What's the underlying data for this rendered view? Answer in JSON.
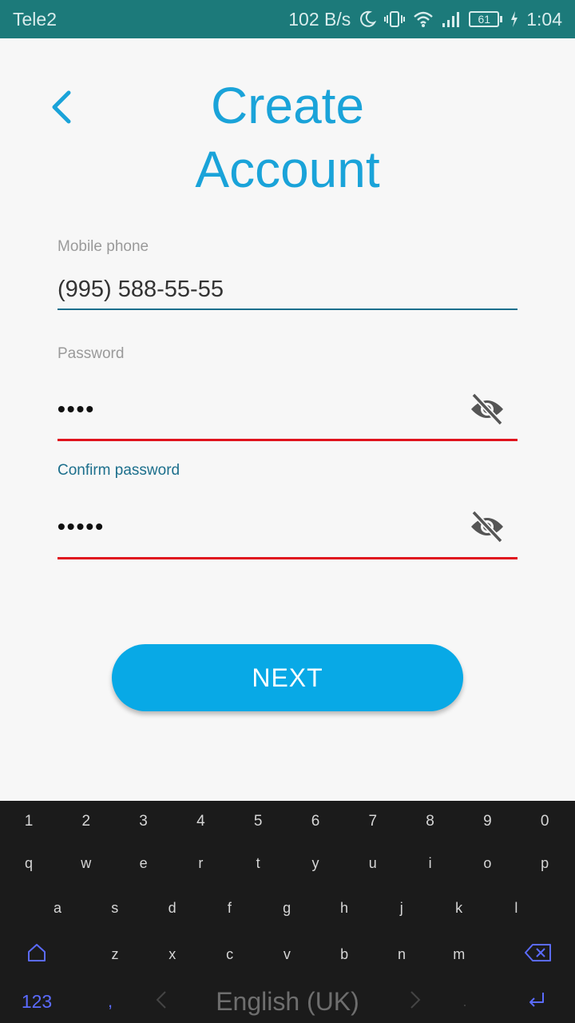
{
  "status_bar": {
    "carrier": "Tele2",
    "speed": "102 B/s",
    "battery": "61",
    "time": "1:04"
  },
  "header": {
    "title_line1": "Create",
    "title_line2": "Account"
  },
  "form": {
    "phone_label": "Mobile phone",
    "phone_value": "(995) 588-55-55",
    "password_label": "Password",
    "password_value": "••••",
    "confirm_label": "Confirm password",
    "confirm_value": "•••••"
  },
  "next_label": "NEXT",
  "keyboard": {
    "row_numbers": [
      "1",
      "2",
      "3",
      "4",
      "5",
      "6",
      "7",
      "8",
      "9",
      "0"
    ],
    "row_1": [
      "q",
      "w",
      "e",
      "r",
      "t",
      "y",
      "u",
      "i",
      "o",
      "p"
    ],
    "row_2": [
      "a",
      "s",
      "d",
      "f",
      "g",
      "h",
      "j",
      "k",
      "l"
    ],
    "row_3": [
      "z",
      "x",
      "c",
      "v",
      "b",
      "n",
      "m"
    ],
    "key_123": "123",
    "key_comma": ",",
    "space_label": "English (UK)",
    "key_period": "."
  },
  "colors": {
    "accent": "#1aa3d9",
    "button": "#08a9e6",
    "error": "#e0141e",
    "status_bar": "#1c7a7a",
    "keyboard_bg": "#1b1b1b"
  }
}
